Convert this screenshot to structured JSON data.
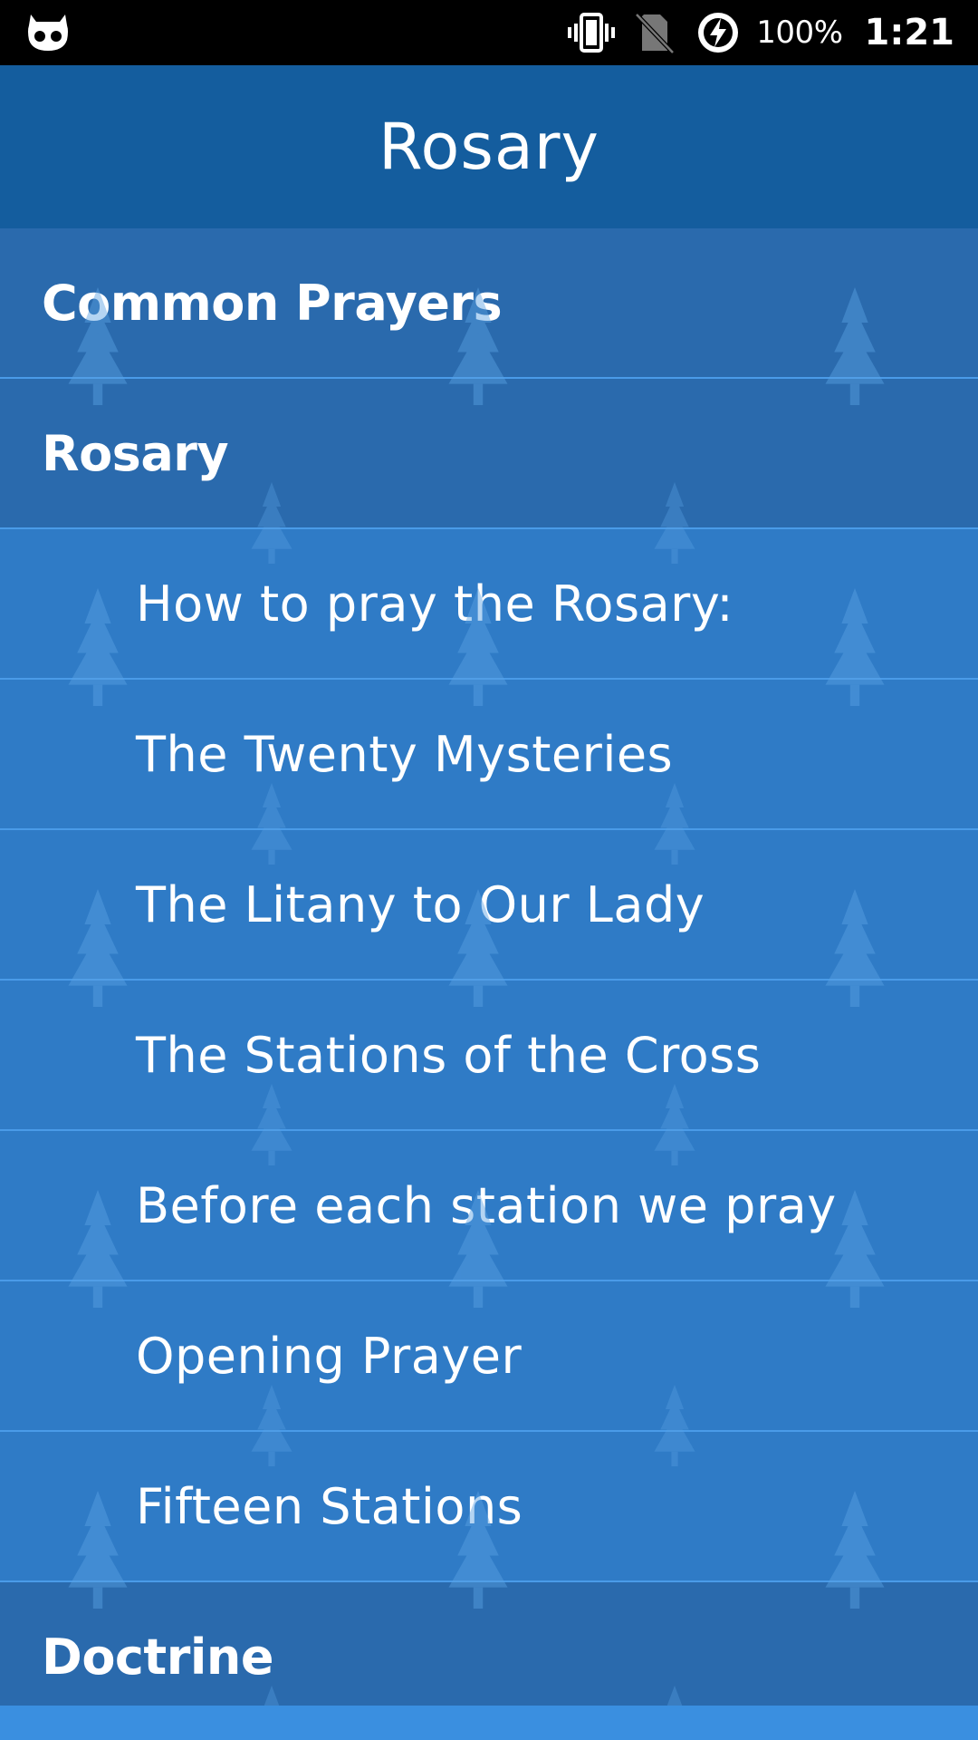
{
  "status_bar": {
    "app_icon": "cyanogen-mascot-icon",
    "icons": [
      "vibrate-icon",
      "no-sim-icon",
      "battery-charging-icon"
    ],
    "battery": "100%",
    "time": "1:21"
  },
  "app_bar": {
    "title": "Rosary"
  },
  "list": {
    "items": [
      {
        "label": "Common Prayers",
        "kind": "group"
      },
      {
        "label": "Rosary",
        "kind": "group"
      },
      {
        "label": "How to pray the Rosary:",
        "kind": "child"
      },
      {
        "label": "The Twenty Mysteries",
        "kind": "child"
      },
      {
        "label": "The Litany to Our Lady",
        "kind": "child"
      },
      {
        "label": "The Stations of the Cross",
        "kind": "child"
      },
      {
        "label": "Before each station we pray",
        "kind": "child"
      },
      {
        "label": "Opening Prayer",
        "kind": "child"
      },
      {
        "label": "Fifteen Stations",
        "kind": "child"
      },
      {
        "label": "Doctrine",
        "kind": "group"
      }
    ]
  },
  "colors": {
    "status_bar": "#000000",
    "app_bar": "#145d9e",
    "group_row": "#2a6aad",
    "child_row": "#2f7bc6",
    "divider": "#4a9be8",
    "page": "#3a8fe0"
  }
}
